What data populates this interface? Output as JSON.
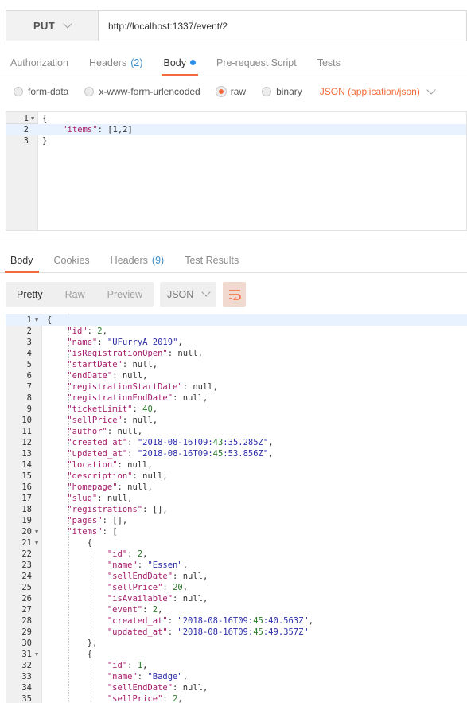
{
  "request": {
    "method": "PUT",
    "url": "http://localhost:1337/event/2"
  },
  "request_tabs": [
    {
      "label": "Authorization",
      "count": ""
    },
    {
      "label": "Headers",
      "count": "(2)"
    },
    {
      "label": "Body",
      "count": "",
      "active": true,
      "dot": true
    },
    {
      "label": "Pre-request Script",
      "count": ""
    },
    {
      "label": "Tests",
      "count": ""
    }
  ],
  "body_types": [
    {
      "label": "form-data",
      "selected": false
    },
    {
      "label": "x-www-form-urlencoded",
      "selected": false
    },
    {
      "label": "raw",
      "selected": true
    },
    {
      "label": "binary",
      "selected": false
    }
  ],
  "content_type": "JSON (application/json)",
  "request_body_lines": [
    {
      "n": "1",
      "fold": true,
      "text": "{"
    },
    {
      "n": "2",
      "fold": false,
      "text": "    \"items\": [1,2]"
    },
    {
      "n": "3",
      "fold": false,
      "text": "}"
    }
  ],
  "response_tabs": [
    {
      "label": "Body",
      "count": "",
      "active": true
    },
    {
      "label": "Cookies",
      "count": ""
    },
    {
      "label": "Headers",
      "count": "(9)"
    },
    {
      "label": "Test Results",
      "count": ""
    }
  ],
  "response_views": [
    {
      "label": "Pretty",
      "active": true
    },
    {
      "label": "Raw",
      "active": false
    },
    {
      "label": "Preview",
      "active": false
    }
  ],
  "response_format": "JSON",
  "response_lines": [
    {
      "n": "1",
      "fold": true,
      "text": "{"
    },
    {
      "n": "2",
      "text": "    \"id\": 2,"
    },
    {
      "n": "3",
      "text": "    \"name\": \"UFurryA 2019\","
    },
    {
      "n": "4",
      "text": "    \"isRegistrationOpen\": null,"
    },
    {
      "n": "5",
      "text": "    \"startDate\": null,"
    },
    {
      "n": "6",
      "text": "    \"endDate\": null,"
    },
    {
      "n": "7",
      "text": "    \"registrationStartDate\": null,"
    },
    {
      "n": "8",
      "text": "    \"registrationEndDate\": null,"
    },
    {
      "n": "9",
      "text": "    \"ticketLimit\": 40,"
    },
    {
      "n": "10",
      "text": "    \"sellPrice\": null,"
    },
    {
      "n": "11",
      "text": "    \"author\": null,"
    },
    {
      "n": "12",
      "text": "    \"created_at\": \"2018-08-16T09:43:35.285Z\","
    },
    {
      "n": "13",
      "text": "    \"updated_at\": \"2018-08-16T09:45:53.856Z\","
    },
    {
      "n": "14",
      "text": "    \"location\": null,"
    },
    {
      "n": "15",
      "text": "    \"description\": null,"
    },
    {
      "n": "16",
      "text": "    \"homepage\": null,"
    },
    {
      "n": "17",
      "text": "    \"slug\": null,"
    },
    {
      "n": "18",
      "text": "    \"registrations\": [],"
    },
    {
      "n": "19",
      "text": "    \"pages\": [],"
    },
    {
      "n": "20",
      "fold": true,
      "text": "    \"items\": ["
    },
    {
      "n": "21",
      "fold": true,
      "text": "        {"
    },
    {
      "n": "22",
      "text": "            \"id\": 2,"
    },
    {
      "n": "23",
      "text": "            \"name\": \"Essen\","
    },
    {
      "n": "24",
      "text": "            \"sellEndDate\": null,"
    },
    {
      "n": "25",
      "text": "            \"sellPrice\": 20,"
    },
    {
      "n": "26",
      "text": "            \"isAvailable\": null,"
    },
    {
      "n": "27",
      "text": "            \"event\": 2,"
    },
    {
      "n": "28",
      "text": "            \"created_at\": \"2018-08-16T09:45:40.563Z\","
    },
    {
      "n": "29",
      "text": "            \"updated_at\": \"2018-08-16T09:45:49.357Z\""
    },
    {
      "n": "30",
      "text": "        },"
    },
    {
      "n": "31",
      "fold": true,
      "text": "        {"
    },
    {
      "n": "32",
      "text": "            \"id\": 1,"
    },
    {
      "n": "33",
      "text": "            \"name\": \"Badge\","
    },
    {
      "n": "34",
      "text": "            \"sellEndDate\": null,"
    },
    {
      "n": "35",
      "text": "            \"sellPrice\": 2,"
    }
  ]
}
